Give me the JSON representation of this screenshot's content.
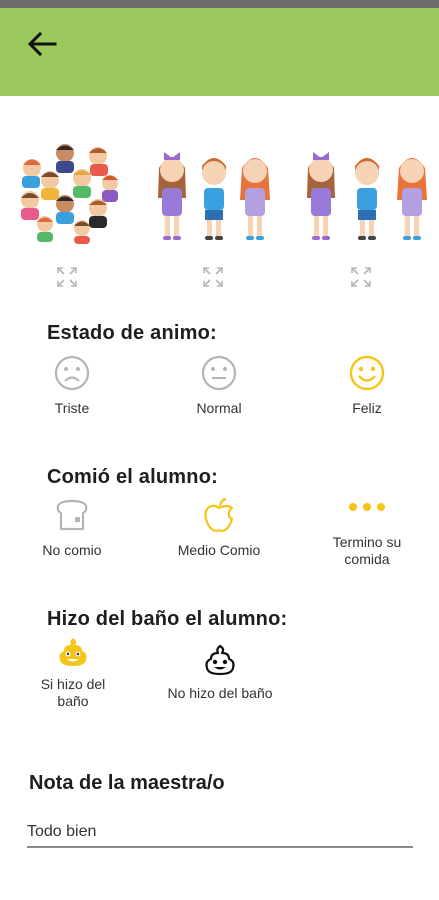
{
  "header": {
    "back_icon": "arrow-left-icon",
    "color": "#9bc95e"
  },
  "photos": [
    {
      "name": "group-of-children-photo",
      "expand_icon": "expand-icon"
    },
    {
      "name": "three-children-photo",
      "expand_icon": "expand-icon"
    },
    {
      "name": "three-children-photo",
      "expand_icon": "expand-icon"
    }
  ],
  "mood": {
    "title": "Estado de animo:",
    "options": [
      {
        "label": "Triste",
        "icon": "sad-face-icon",
        "selected": false
      },
      {
        "label": "Normal",
        "icon": "neutral-face-icon",
        "selected": false
      },
      {
        "label": "Feliz",
        "icon": "happy-face-icon",
        "selected": true
      }
    ]
  },
  "meal": {
    "title": "Comió el alumno:",
    "options": [
      {
        "label": "No comio",
        "icon": "bread-icon",
        "selected": false
      },
      {
        "label": "Medio Comio",
        "icon": "apple-icon",
        "selected": true
      },
      {
        "label": "Termino su comida",
        "icon": "three-dots-icon",
        "selected": false
      }
    ]
  },
  "bathroom": {
    "title": "Hizo del baño el alumno:",
    "options": [
      {
        "label": "Si hizo del baño",
        "icon": "poop-happy-icon",
        "selected": true
      },
      {
        "label": "No hizo del baño",
        "icon": "poop-icon",
        "selected": false
      }
    ]
  },
  "note": {
    "title": "Nota de la maestra/o",
    "value": "Todo bien"
  },
  "colors": {
    "selected": "#f5c518",
    "unselected": "#b5b5b5",
    "accent": "#9bc95e"
  }
}
